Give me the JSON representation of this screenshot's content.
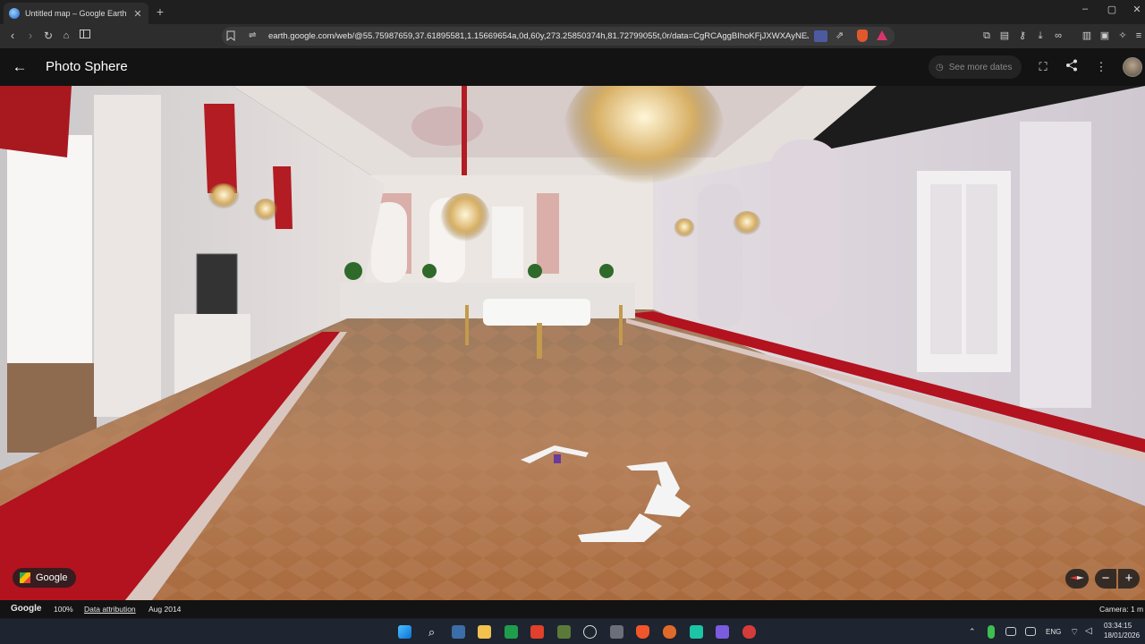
{
  "browser": {
    "tab_title": "Untitled map – Google Earth",
    "tab_close": "✕",
    "new_tab": "+",
    "window_controls": {
      "minimize": "–",
      "maximize": "▢",
      "close": "✕"
    },
    "url": "earth.google.com/web/@55.75987659,37.61895581,1.15669654a,0d,60y,273.25850374h,81.72799055t,0r/data=CgRCAggBIhoKFjJXWXAyNEJkaX..."
  },
  "earth": {
    "page_title": "Photo Sphere",
    "see_more_dates": "See more dates",
    "google_chip": "Google",
    "zoom_out": "−",
    "zoom_in": "+"
  },
  "status": {
    "google": "Google",
    "zoom": "100%",
    "data_attribution": "Data attribution",
    "date": "Aug 2014",
    "camera": "Camera: 1 m"
  },
  "taskbar": {
    "language": "ENG",
    "time": "03:34:15",
    "date": "18/01/2026"
  }
}
